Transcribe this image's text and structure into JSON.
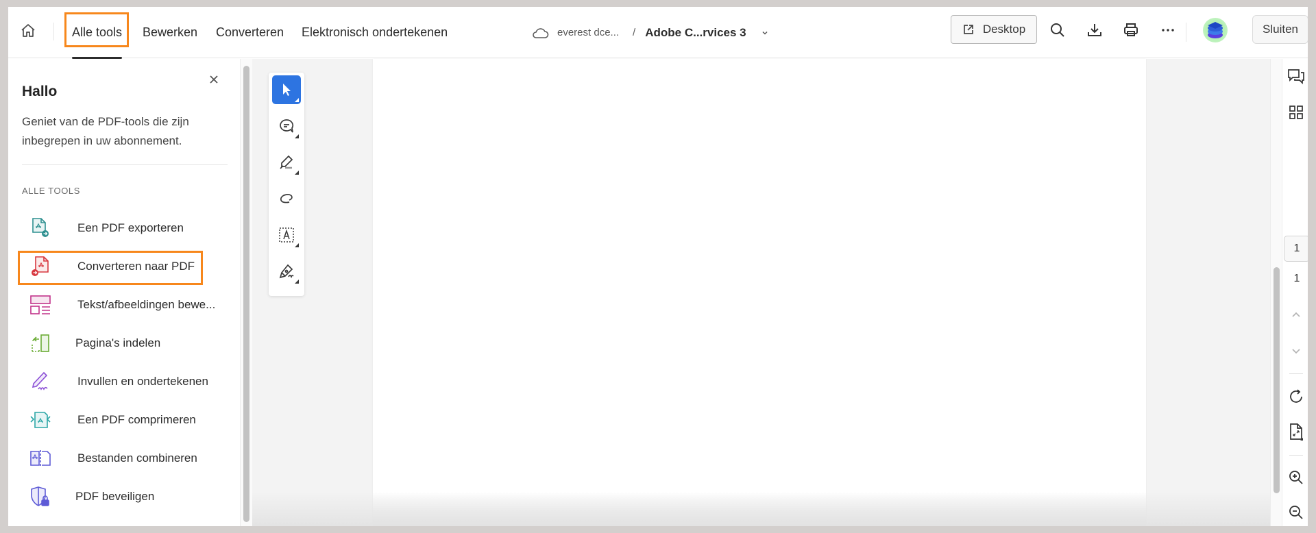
{
  "header": {
    "home_icon": "home-icon",
    "tabs": [
      {
        "label": "Alle tools",
        "active": true
      },
      {
        "label": "Bewerken",
        "active": false
      },
      {
        "label": "Converteren",
        "active": false
      },
      {
        "label": "Elektronisch ondertekenen",
        "active": false
      }
    ],
    "breadcrumb": {
      "storage_icon": "cloud-icon",
      "root": "everest dce...",
      "separator": "/",
      "document": "Adobe C...rvices 3"
    },
    "desktop_button": "Desktop",
    "actions": [
      "search-icon",
      "download-icon",
      "print-icon",
      "more-icon"
    ],
    "close_button": "Sluiten"
  },
  "left_panel": {
    "title": "Hallo",
    "description": "Geniet van de PDF-tools die zijn inbegrepen in uw abonnement.",
    "section_label": "ALLE TOOLS",
    "tools": [
      {
        "label": "Een PDF exporteren",
        "icon": "export-pdf-icon",
        "color": "#2d8f8f"
      },
      {
        "label": "Converteren naar PDF",
        "icon": "create-pdf-icon",
        "color": "#d7373f"
      },
      {
        "label": "Tekst/afbeeldingen bewe...",
        "icon": "edit-pdf-icon",
        "color": "#c2338a"
      },
      {
        "label": "Pagina's indelen",
        "icon": "organize-pages-icon",
        "color": "#6aac34"
      },
      {
        "label": "Invullen en ondertekenen",
        "icon": "fill-sign-icon",
        "color": "#8b4fd6"
      },
      {
        "label": "Een PDF comprimeren",
        "icon": "compress-pdf-icon",
        "color": "#2ba6a6"
      },
      {
        "label": "Bestanden combineren",
        "icon": "combine-files-icon",
        "color": "#5e5bd6"
      },
      {
        "label": "PDF beveiligen",
        "icon": "protect-pdf-icon",
        "color": "#5e5bd6"
      }
    ]
  },
  "annotation_highlights": [
    "Alle tools",
    "Converteren naar PDF"
  ],
  "highlight_color": "#f7871c",
  "toolbar": {
    "tools": [
      {
        "name": "select-tool",
        "active": true
      },
      {
        "name": "comment-tool",
        "active": false
      },
      {
        "name": "highlight-tool",
        "active": false
      },
      {
        "name": "draw-tool",
        "active": false
      },
      {
        "name": "text-tool",
        "active": false
      },
      {
        "name": "sign-tool",
        "active": false
      }
    ],
    "accent": "#2d74e1"
  },
  "right_rail": {
    "current_page": "1",
    "total_pages": "1"
  }
}
